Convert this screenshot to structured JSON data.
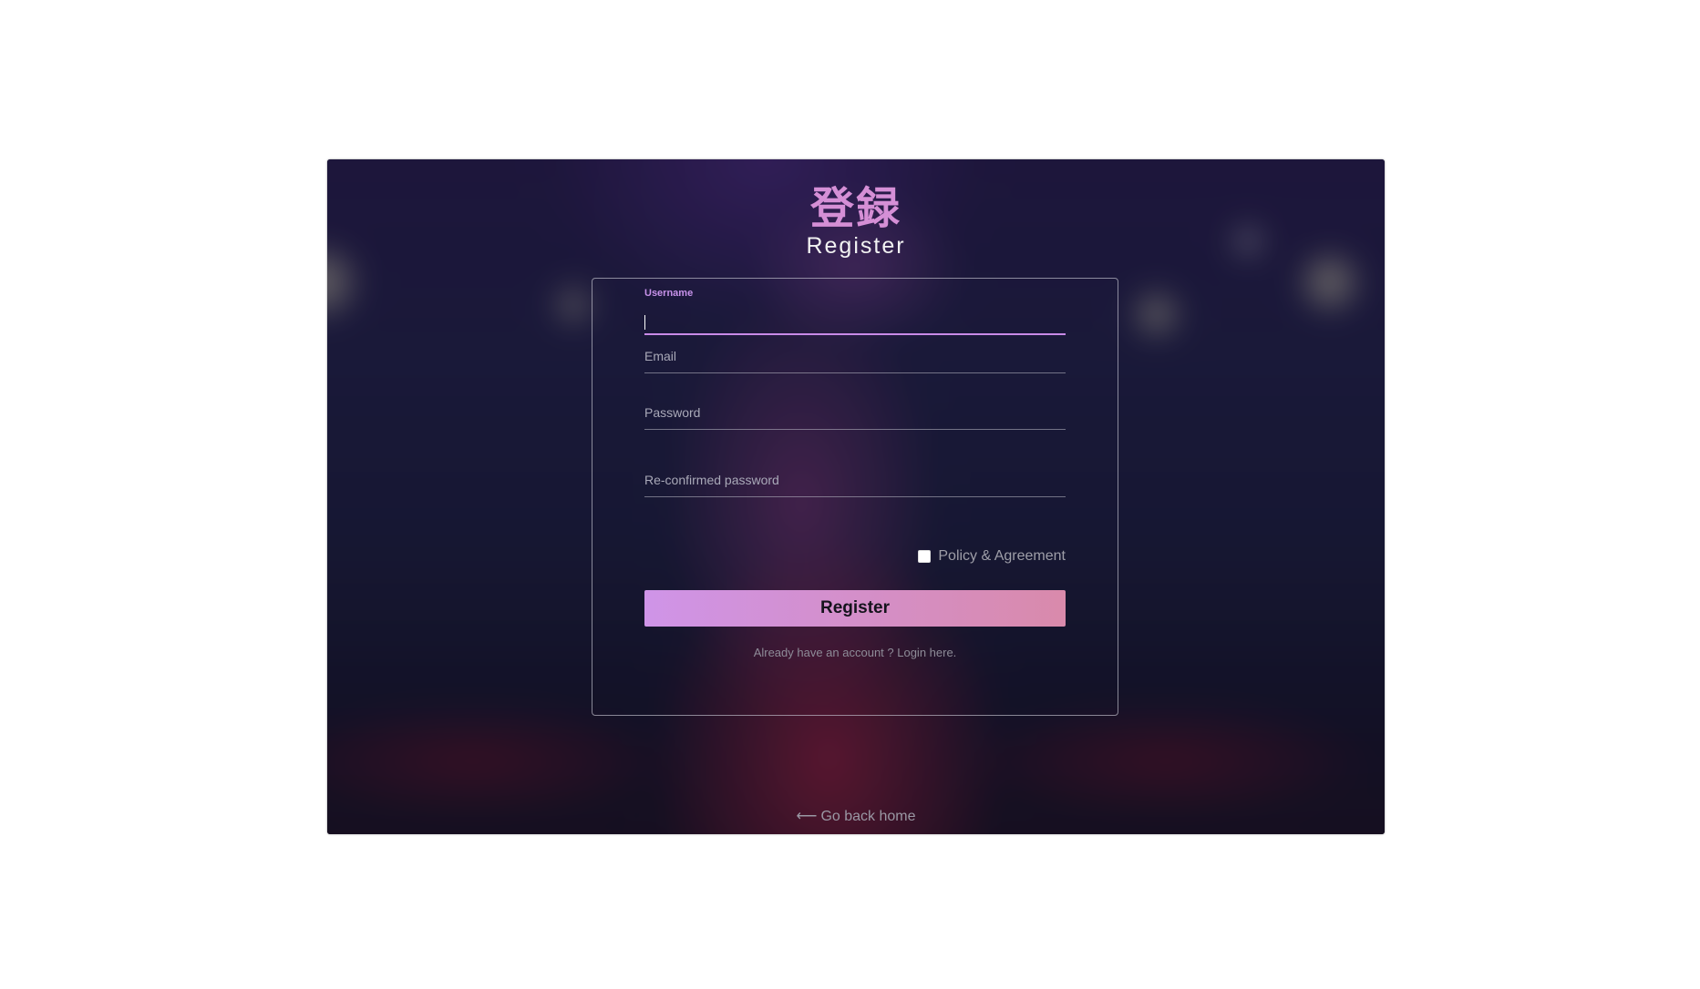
{
  "header": {
    "title_jp": "登録",
    "title_en": "Register"
  },
  "form": {
    "username": {
      "label": "Username",
      "value": ""
    },
    "email": {
      "placeholder": "Email",
      "value": ""
    },
    "password": {
      "placeholder": "Password",
      "value": ""
    },
    "confirm_password": {
      "placeholder": "Re-confirmed password",
      "value": ""
    },
    "policy": {
      "label": "Policy & Agreement",
      "checked": false
    },
    "submit_label": "Register",
    "login_link": "Already have an account ? Login here."
  },
  "footer": {
    "back_home_arrow": "⟵",
    "back_home_label": "Go back home"
  },
  "colors": {
    "accent": "#d58fd6",
    "button_start": "#cf94e8",
    "button_end": "#d98aab"
  }
}
